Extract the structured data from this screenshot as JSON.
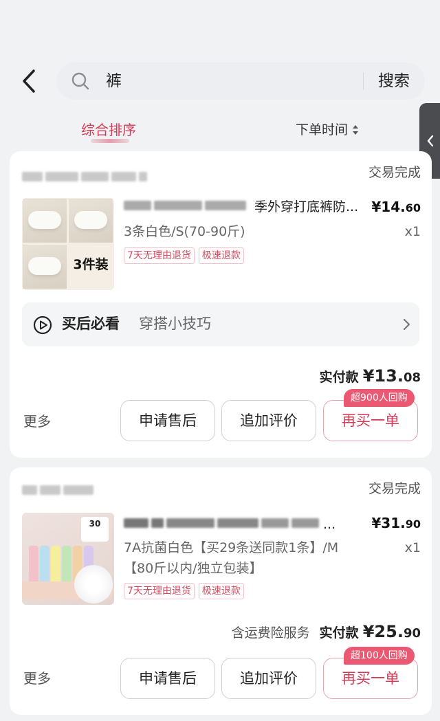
{
  "search": {
    "query": "裤",
    "button_label": "搜索"
  },
  "sort": {
    "active_tab": "综合排序",
    "time_tab": "下单时间"
  },
  "orders": [
    {
      "status": "交易完成",
      "product_title": "季外穿打底裤防...",
      "price_main": "¥14.",
      "price_cents": "60",
      "spec": "3条白色/S(70-90斤)",
      "quantity": "x1",
      "thumb_badge": "3件装",
      "tags": [
        "7天无理由退货",
        "极速退款"
      ],
      "tips": {
        "title": "买后必看",
        "subtitle": "穿搭小技巧"
      },
      "paid_label": "实付款",
      "paid_main": "¥13.",
      "paid_cents": "08",
      "more_label": "更多",
      "buttons": [
        "申请售后",
        "追加评价",
        "再买一单"
      ],
      "repurchase_badge": "超900人回购"
    },
    {
      "status": "交易完成",
      "product_title": "...",
      "price_main": "¥31.",
      "price_cents": "90",
      "spec_line1": "7A抗菌白色【买29条送同款1条】/M",
      "spec_line2": "【80斤以内/独立包装】",
      "quantity": "x1",
      "thumb_badge": "30",
      "tags": [
        "7天无理由退货",
        "极速退款"
      ],
      "service_label": "含运费险服务",
      "paid_label": "实付款",
      "paid_main": "¥25.",
      "paid_cents": "90",
      "more_label": "更多",
      "buttons": [
        "申请售后",
        "追加评价",
        "再买一单"
      ],
      "repurchase_badge": "超100人回购"
    }
  ],
  "colors": {
    "accent": "#d43b56",
    "badge": "#ea5872",
    "background": "#f1f2f4"
  },
  "icons": [
    "back-arrow-icon",
    "search-icon",
    "sort-arrows-icon",
    "side-chevron-icon",
    "play-icon",
    "chevron-right-icon"
  ]
}
